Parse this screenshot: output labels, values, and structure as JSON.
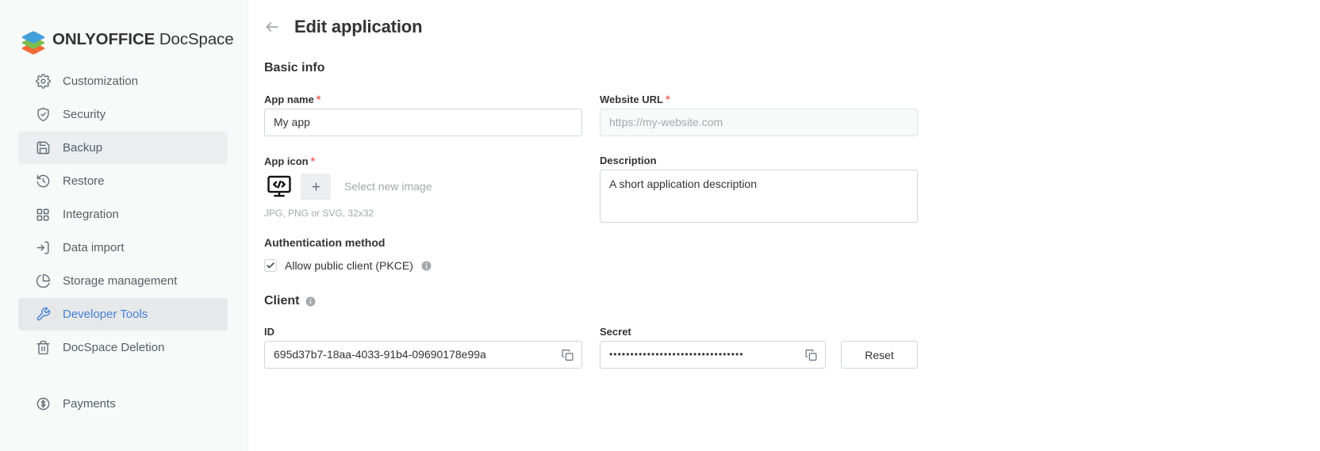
{
  "brand": {
    "name_bold": "ONLYOFFICE",
    "name_light": " DocSpace",
    "logo_colors": [
      "#44a0d9",
      "#7cbe4d",
      "#f26a35"
    ]
  },
  "sidebar": {
    "items": [
      {
        "label": "Customization",
        "icon": "gear-icon",
        "active": false
      },
      {
        "label": "Security",
        "icon": "shield-check-icon",
        "active": false
      },
      {
        "label": "Backup",
        "icon": "floppy-disk-icon",
        "active": false,
        "hovered": true
      },
      {
        "label": "Restore",
        "icon": "restore-clock-icon",
        "active": false
      },
      {
        "label": "Integration",
        "icon": "grid-squares-icon",
        "active": false
      },
      {
        "label": "Data import",
        "icon": "import-arrow-icon",
        "active": false
      },
      {
        "label": "Storage management",
        "icon": "pie-chart-icon",
        "active": false
      },
      {
        "label": "Developer Tools",
        "icon": "developer-tools-icon",
        "active": true
      },
      {
        "label": "DocSpace Deletion",
        "icon": "trash-icon",
        "active": false
      }
    ],
    "footer_items": [
      {
        "label": "Payments",
        "icon": "dollar-circle-icon"
      }
    ]
  },
  "header": {
    "back_icon": "arrow-left-icon",
    "title": "Edit application"
  },
  "basic_info": {
    "section_title": "Basic info",
    "app_name": {
      "label": "App name",
      "required_mark": "*",
      "value": "My app"
    },
    "website_url": {
      "label": "Website URL",
      "required_mark": "*",
      "value": "",
      "placeholder": "https://my-website.com"
    },
    "app_icon": {
      "label": "App icon",
      "required_mark": "*",
      "thumb_icon": "code-monitor-icon",
      "plus_icon": "plus-icon",
      "select_label": "Select new image",
      "hint": "JPG, PNG or SVG, 32x32"
    },
    "description": {
      "label": "Description",
      "value": "A short application description"
    },
    "authentication": {
      "label": "Authentication method",
      "checkbox_label": "Allow public client (PKCE)",
      "checked": true,
      "info_icon": "info-icon"
    }
  },
  "client": {
    "section_title": "Client",
    "info_icon": "info-icon",
    "id": {
      "label": "ID",
      "value": "695d37b7-18aa-4033-91b4-09690178e99a",
      "copy_icon": "copy-icon"
    },
    "secret": {
      "label": "Secret",
      "value": "••••••••••••••••••••••••••••••••",
      "copy_icon": "copy-icon"
    },
    "reset_label": "Reset"
  },
  "colors": {
    "accent": "#4781d1",
    "required": "#f2675a",
    "text": "#333333",
    "muted": "#a3a9ae",
    "border": "#d0d5da",
    "sidebar_bg": "#f8f9f9",
    "active_bg": "#e6e8ea"
  }
}
